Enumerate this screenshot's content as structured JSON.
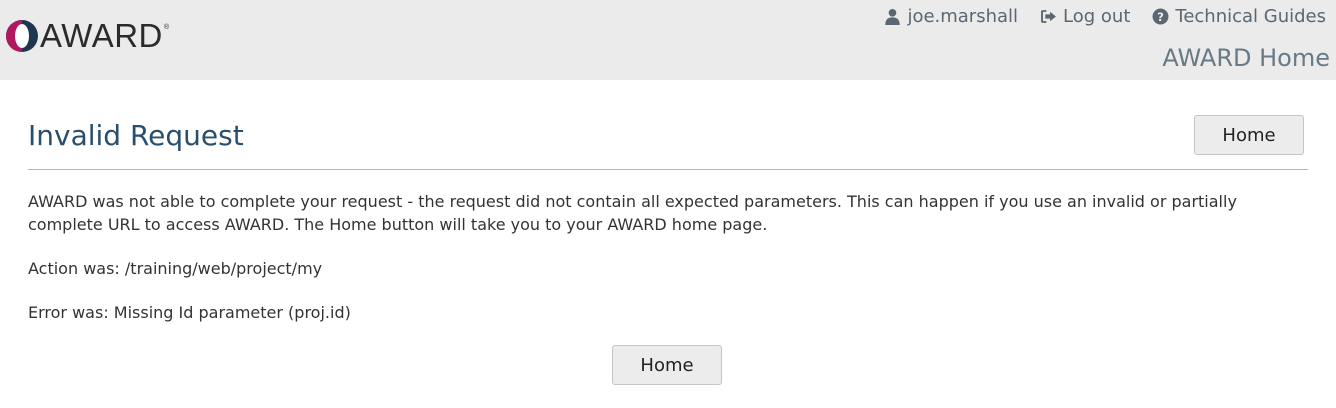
{
  "header": {
    "logo_text": "AWARD",
    "logo_reg": "®",
    "nav": {
      "user": {
        "label": "joe.marshall",
        "icon": "user-icon"
      },
      "logout": {
        "label": "Log out",
        "icon": "logout-icon"
      },
      "guides": {
        "label": "Technical Guides",
        "icon": "question-circle-icon"
      }
    },
    "app_title": "AWARD Home"
  },
  "main": {
    "title": "Invalid Request",
    "home_button_label": "Home",
    "message": "AWARD was not able to complete your request - the request did not contain all expected parameters. This can happen if you use an invalid or partially complete URL to access AWARD. The Home button will take you to your AWARD home page.",
    "action": "Action was: /training/web/project/my",
    "error": "Error was: Missing Id parameter (proj.id)",
    "bottom_button_label": "Home"
  },
  "colors": {
    "header_bg": "#ebebeb",
    "title_color": "#2a4f6e",
    "logo_magenta": "#b0185f",
    "logo_navy": "#1f3552"
  }
}
